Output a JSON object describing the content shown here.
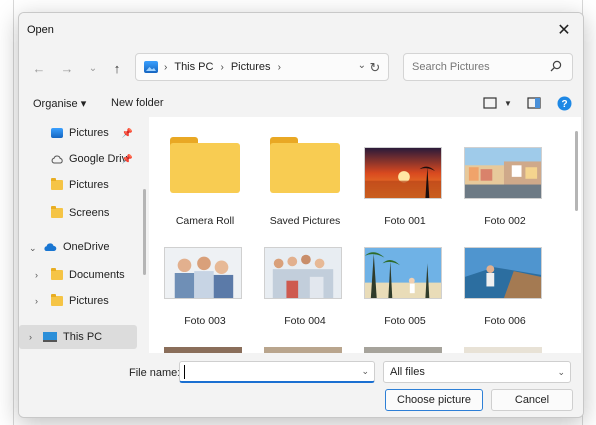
{
  "dialog": {
    "title": "Open",
    "close_glyph": "✕"
  },
  "nav": {
    "back_glyph": "←",
    "forward_glyph": "→",
    "recent_glyph": "⌄",
    "up_glyph": "↑",
    "breadcrumb": [
      "This PC",
      "Pictures"
    ],
    "refresh_glyph": "↻",
    "search_placeholder": "Search Pictures"
  },
  "toolbar": {
    "organise_label": "Organise ▾",
    "new_folder_label": "New folder"
  },
  "sidebar": {
    "items": [
      {
        "label": "Pictures",
        "icon": "pictures-icon",
        "pinned": true
      },
      {
        "label": "Google Drive",
        "icon": "google-drive-icon",
        "pinned": true
      },
      {
        "label": "Pictures",
        "icon": "folder-icon",
        "pinned": false
      },
      {
        "label": "Screens",
        "icon": "folder-icon",
        "pinned": false
      },
      {
        "label": "OneDrive",
        "icon": "onedrive-icon",
        "expanded": true
      },
      {
        "label": "Documents",
        "icon": "folder-icon",
        "collapsed": true
      },
      {
        "label": "Pictures",
        "icon": "folder-icon",
        "collapsed": true
      },
      {
        "label": "This PC",
        "icon": "monitor-icon",
        "collapsed": true,
        "selected": true
      }
    ]
  },
  "files": [
    {
      "name": "Camera Roll",
      "kind": "folder"
    },
    {
      "name": "Saved Pictures",
      "kind": "folder"
    },
    {
      "name": "Foto 001",
      "kind": "image",
      "scene": "sunset"
    },
    {
      "name": "Foto 002",
      "kind": "image",
      "scene": "coastal-town"
    },
    {
      "name": "Foto 003",
      "kind": "image",
      "scene": "family"
    },
    {
      "name": "Foto 004",
      "kind": "image",
      "scene": "family-group"
    },
    {
      "name": "Foto 005",
      "kind": "image",
      "scene": "palm-beach"
    },
    {
      "name": "Foto 006",
      "kind": "image",
      "scene": "coast-woman"
    }
  ],
  "footer": {
    "file_name_label": "File name:",
    "file_name_value": "",
    "file_type_value": "All files",
    "open_button": "Choose picture",
    "cancel_button": "Cancel"
  },
  "colors": {
    "accent": "#1a6fd1",
    "folder": "#f8cc52",
    "dialog_bg": "#f3f3f3",
    "help_icon": "#1e88e5"
  }
}
